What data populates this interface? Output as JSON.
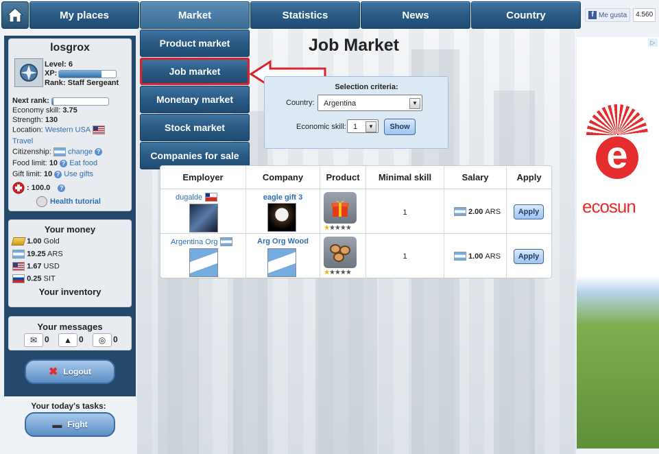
{
  "nav": {
    "items": [
      "My places",
      "Market",
      "Statistics",
      "News",
      "Country"
    ]
  },
  "facebook": {
    "like_label": "Me gusta",
    "count": "4.560"
  },
  "market_menu": {
    "items": [
      "Product market",
      "Job market",
      "Monetary market",
      "Stock market",
      "Companies for sale"
    ],
    "selected": "Job market"
  },
  "profile": {
    "username": "losgrox",
    "level_label": "Level: 6",
    "xp_label": "XP:",
    "xp_progress": 0.75,
    "rank_label": "Rank: Staff Sergeant",
    "next_rank_label": "Next rank:",
    "next_rank_progress": 0.02,
    "economy_skill_label": "Economy skill:",
    "economy_skill": "3.75",
    "strength_label": "Strength:",
    "strength": "130",
    "location_label": "Location:",
    "location": "Western USA",
    "travel": "Travel",
    "citizenship_label": "Citizenship:",
    "citizenship_action": "change",
    "food_limit_label": "Food limit:",
    "food_limit": "10",
    "food_action": "Eat food",
    "gift_limit_label": "Gift limit:",
    "gift_limit": "10",
    "gift_action": "Use gifts",
    "health": ": 100.0",
    "health_tutorial": "Health tutorial"
  },
  "money": {
    "title": "Your money",
    "rows": [
      {
        "amount": "1.00",
        "currency": "Gold"
      },
      {
        "amount": "19.25",
        "currency": "ARS"
      },
      {
        "amount": "1.67",
        "currency": "USD"
      },
      {
        "amount": "0.25",
        "currency": "SIT"
      }
    ],
    "inventory": "Your inventory"
  },
  "messages": {
    "title": "Your messages",
    "mail": "0",
    "alerts": "0",
    "feeds": "0"
  },
  "logout": "Logout",
  "tasks": {
    "title": "Your today's tasks:",
    "fight": "Fight"
  },
  "page": {
    "title": "Job Market"
  },
  "criteria": {
    "title": "Selection criteria:",
    "country_label": "Country:",
    "country_value": "Argentina",
    "skill_label": "Economic skill:",
    "skill_value": "1",
    "show_label": "Show"
  },
  "table": {
    "headers": [
      "Employer",
      "Company",
      "Product",
      "Minimal skill",
      "Salary",
      "Apply"
    ],
    "rows": [
      {
        "employer": "dugalde",
        "company": "eagle gift 3",
        "product": "gift",
        "quality": 1,
        "min_skill": "1",
        "salary": "2.00",
        "currency": "ARS",
        "apply": "Apply"
      },
      {
        "employer": "Argentina Org",
        "company": "Arg Org Wood",
        "product": "wood",
        "quality": 1,
        "min_skill": "1",
        "salary": "1.00",
        "currency": "ARS",
        "apply": "Apply"
      }
    ]
  },
  "ad": {
    "brand": "ecosun",
    "letter": "e"
  },
  "colors": {
    "nav": "#2a5a84",
    "sidebar": "#24496b",
    "highlight": "#d9232a",
    "link": "#2c6db5"
  }
}
